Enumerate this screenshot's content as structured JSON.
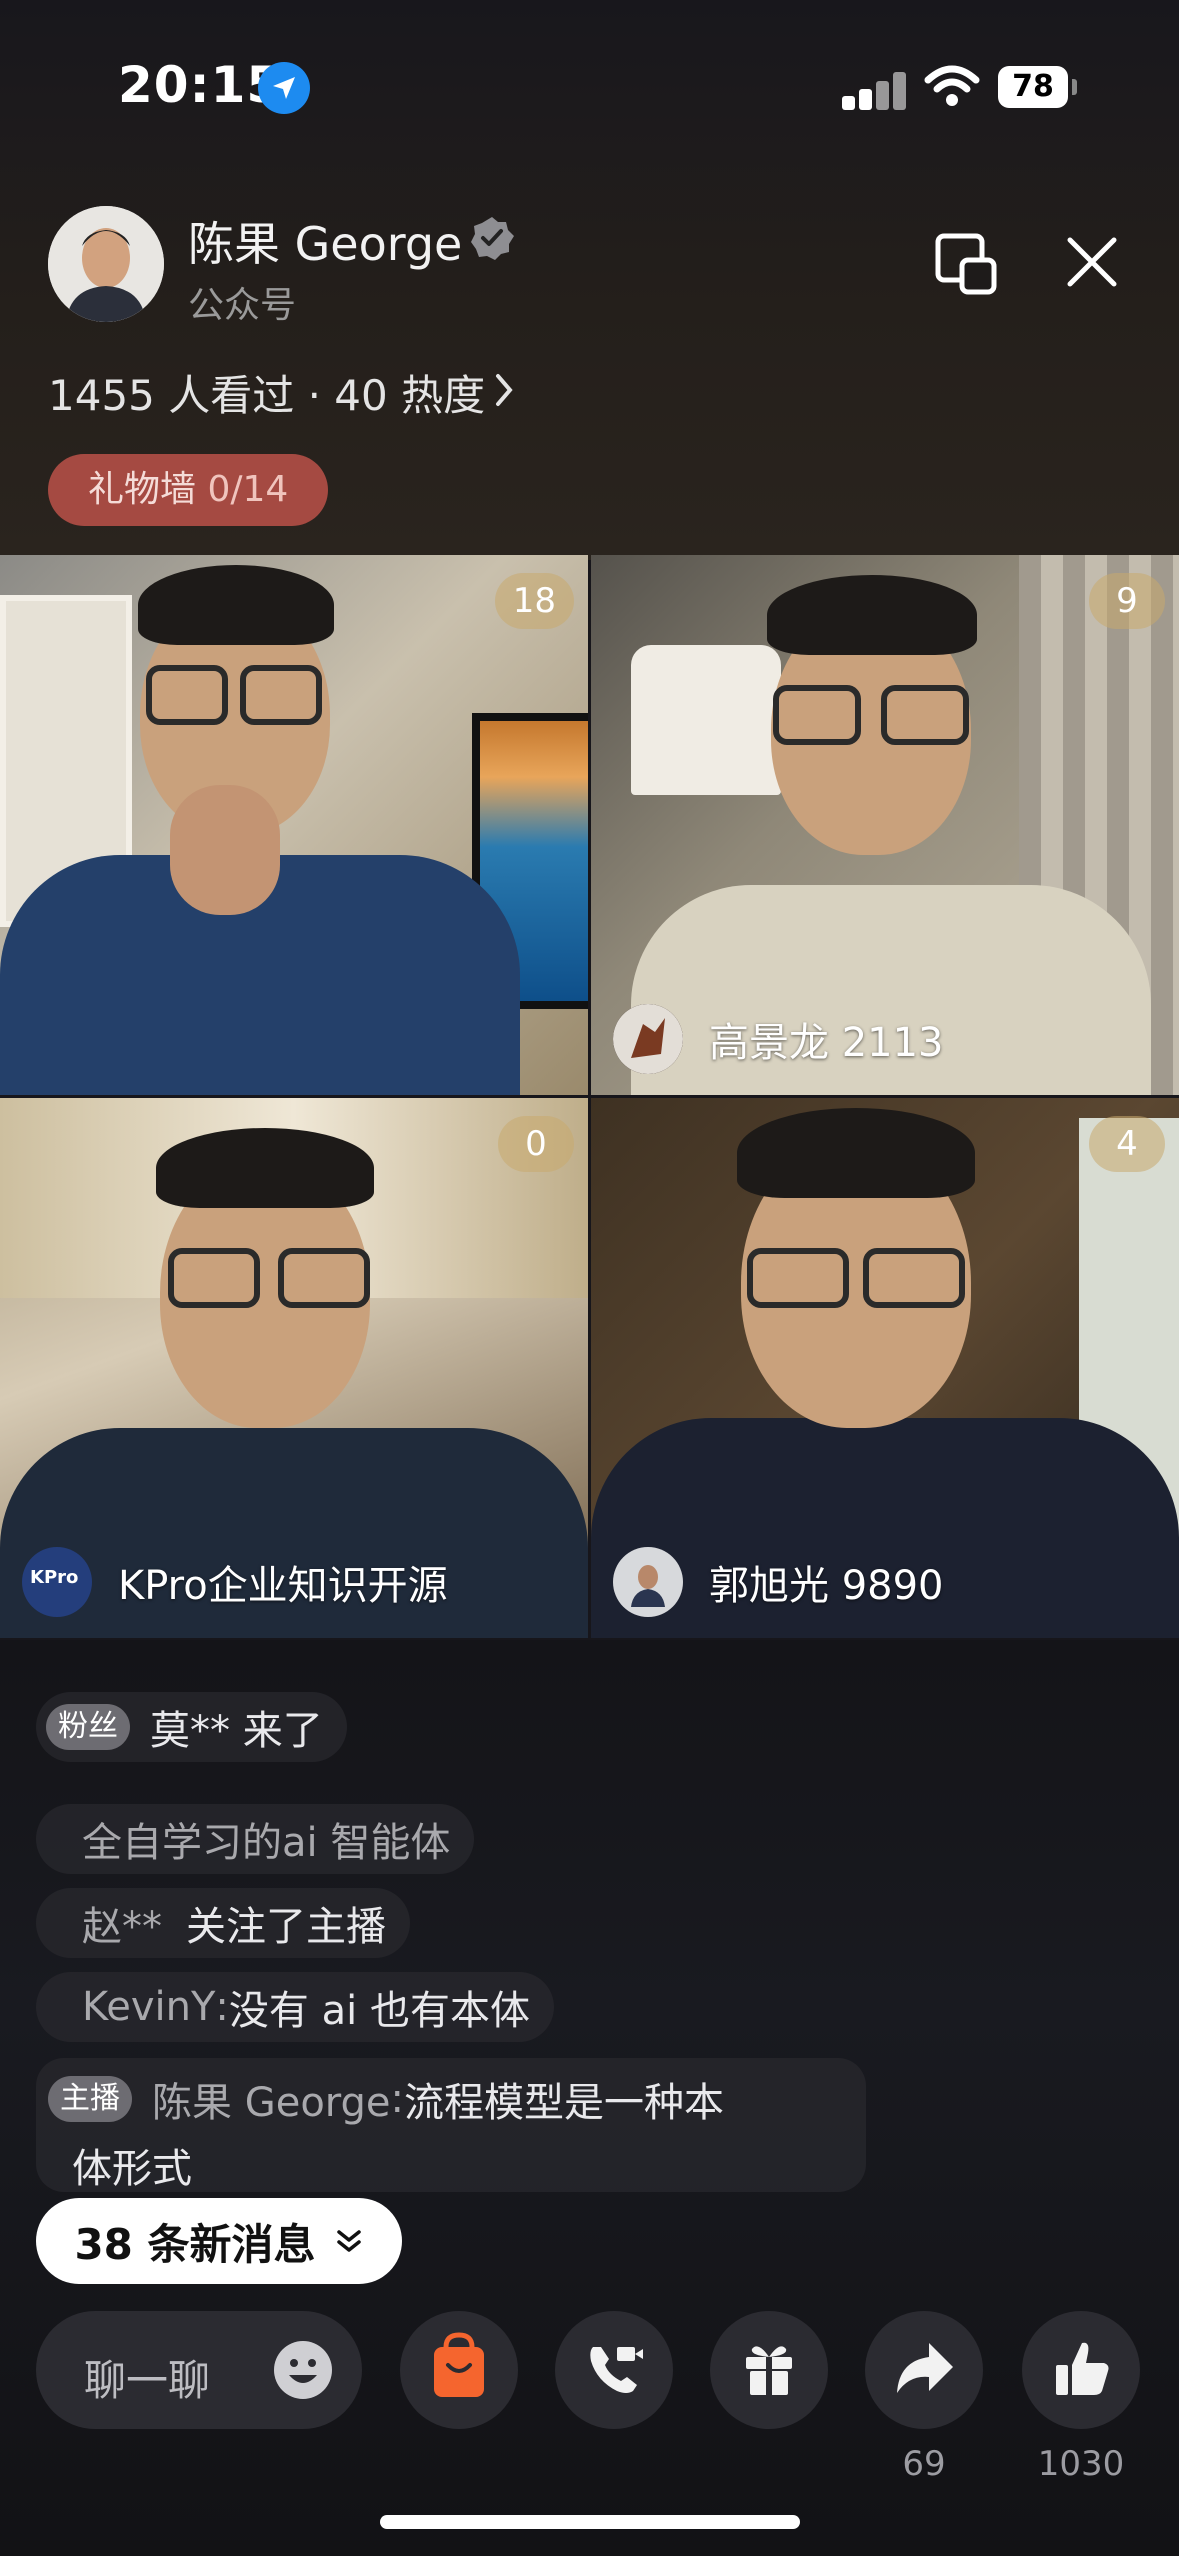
{
  "status_bar": {
    "time": "20:15",
    "battery": "78"
  },
  "header": {
    "host_name": "陈果 George",
    "host_subtitle": "公众号",
    "stats": "1455 人看过 · 40 热度",
    "gift_wall_label": "礼物墙",
    "gift_wall_count": "0/14"
  },
  "video_tiles": [
    {
      "count": "18",
      "name": ""
    },
    {
      "count": "9",
      "name": "高景龙 2113"
    },
    {
      "count": "0",
      "name": "KPro企业知识开源"
    },
    {
      "count": "4",
      "name": "郭旭光 9890"
    }
  ],
  "mini_logo_text": "KPro",
  "chat": {
    "messages": [
      {
        "tag": "粉丝",
        "text": "莫** 来了"
      },
      {
        "text": "全自学习的ai 智能体"
      },
      {
        "user": "赵**",
        "text": "关注了主播"
      },
      {
        "user": "KevinY",
        "sep": ":",
        "text": "没有 ai 也有本体"
      }
    ],
    "host_message": {
      "tag": "主播",
      "user": "陈果 George",
      "sep": ":",
      "text_line1": "流程模型是一种本",
      "text_line2": "体形式"
    }
  },
  "new_messages_label": "38 条新消息",
  "bottom_bar": {
    "chat_placeholder": "聊一聊",
    "share_count": "69",
    "like_count": "1030"
  },
  "colors": {
    "gift_wall": "#a54a42",
    "shop": "#f5652e",
    "location": "#1d8bf0"
  }
}
